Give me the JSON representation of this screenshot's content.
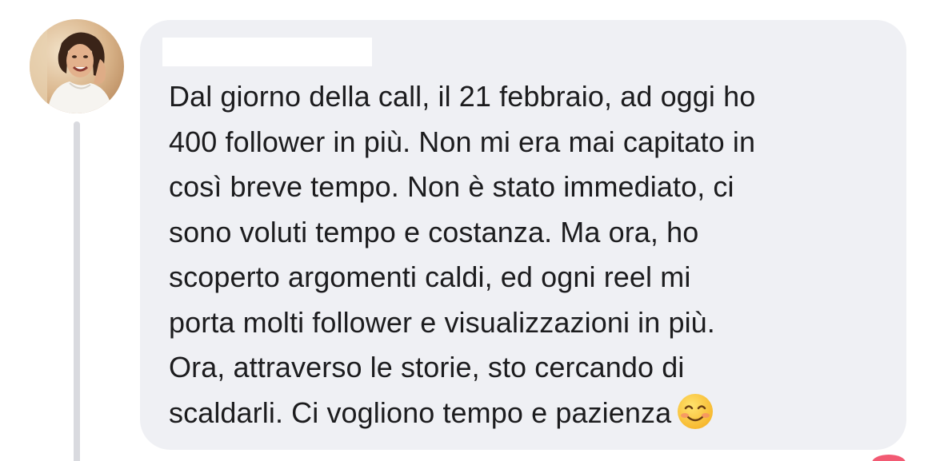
{
  "author": {
    "name": ""
  },
  "comment": {
    "lines": [
      "Dal giorno della call, il 21 febbraio, ad oggi ho",
      "400 follower in più. Non mi era mai capitato in",
      "così breve tempo. Non è stato immediato, ci",
      "sono voluti tempo e costanza. Ma ora, ho",
      "scoperto argomenti caldi, ed ogni reel mi",
      "porta molti follower e visualizzazioni in più.",
      "Ora, attraverso le storie, sto cercando di",
      "scaldarli. Ci vogliono tempo e pazienza"
    ],
    "emoji": "smiling-face-icon"
  },
  "colors": {
    "bubble": "#eff0f4",
    "text": "#1c1c1e",
    "thread_line": "#d9dadf",
    "badge": "#f25a73"
  }
}
